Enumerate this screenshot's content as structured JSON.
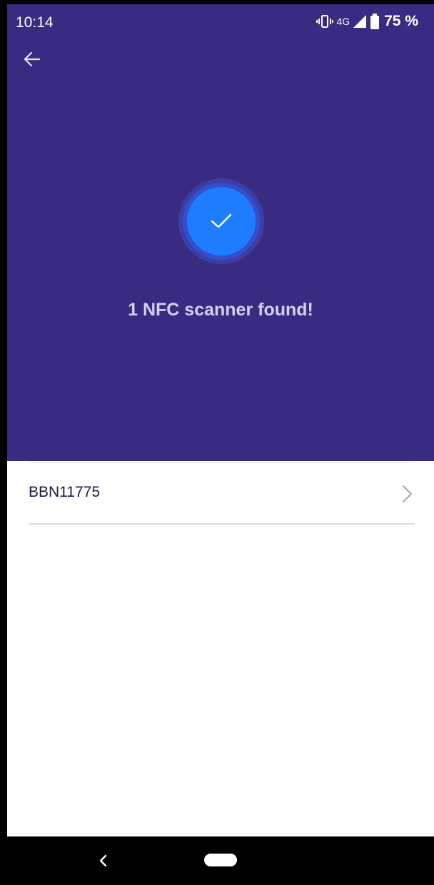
{
  "status_bar": {
    "time": "10:14",
    "network": "4G",
    "battery": "75 %"
  },
  "header": {
    "background_color": "#3a2b82",
    "back_icon": "arrow-left-icon",
    "success_icon": "checkmark-icon",
    "title": "1 NFC scanner found!"
  },
  "devices": [
    {
      "name": "BBN11775",
      "icon": "chevron-right-icon"
    }
  ],
  "nav_bar": {
    "back_icon": "chevron-left-icon",
    "home_icon": "home-pill-icon"
  }
}
